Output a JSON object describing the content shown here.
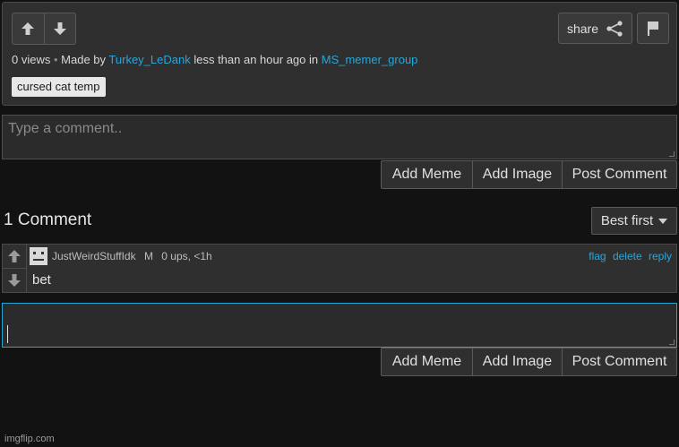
{
  "post": {
    "views": "0 views",
    "made_by_prefix": "Made by",
    "author": "Turkey_LeDank",
    "time_text": "less than an hour ago in",
    "group": "MS_memer_group",
    "tag": "cursed cat temp",
    "share_label": "share"
  },
  "composer_top": {
    "placeholder": "Type a comment..",
    "buttons": [
      "Add Meme",
      "Add Image",
      "Post Comment"
    ]
  },
  "comments_header": {
    "count_label": "1 Comment",
    "sort_label": "Best first"
  },
  "comment": {
    "username": "JustWeirdStuffIdk",
    "badge": "M",
    "stats": "0 ups, <1h",
    "actions": [
      "flag",
      "delete",
      "reply"
    ],
    "text": "bet"
  },
  "composer_reply": {
    "value": "",
    "buttons": [
      "Add Meme",
      "Add Image",
      "Post Comment"
    ]
  },
  "footer": "imgflip.com",
  "colors": {
    "link": "#2aa6d8",
    "focus_border": "#23a8d6",
    "background": "#121212"
  },
  "icons": [
    "arrow-up-icon",
    "arrow-down-icon",
    "share-icon",
    "flag-icon",
    "caret-down-icon",
    "avatar"
  ]
}
